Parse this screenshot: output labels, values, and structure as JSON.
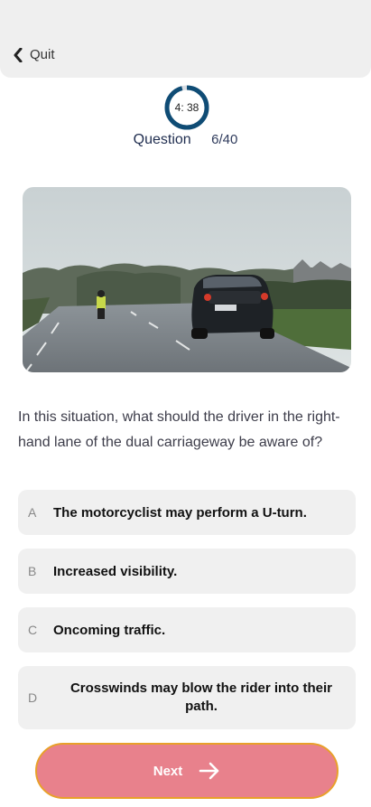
{
  "header": {
    "quit_label": "Quit"
  },
  "timer": {
    "text": "4: 38",
    "progress": 0.96
  },
  "progress": {
    "label": "Question",
    "count": "6/40"
  },
  "question": {
    "text": "In this situation, what should the driver in the right-hand lane of the dual carriageway be aware of?"
  },
  "options": [
    {
      "letter": "A",
      "text": "The motorcyclist may perform a U-turn."
    },
    {
      "letter": "B",
      "text": "Increased visibility."
    },
    {
      "letter": "C",
      "text": "Oncoming traffic."
    },
    {
      "letter": "D",
      "text": "Crosswinds may blow the rider into their path."
    }
  ],
  "footer": {
    "next_label": "Next"
  },
  "colors": {
    "accent": "#0f4c75",
    "next_bg": "#e8818c",
    "next_border": "#e8a02a",
    "option_bg": "#f0f0f0"
  }
}
